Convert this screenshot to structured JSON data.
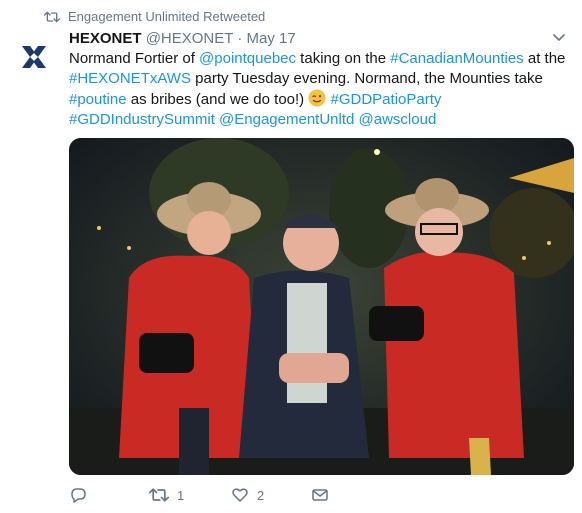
{
  "retweet_context": {
    "icon": "retweet-icon",
    "text": "Engagement Unlimited Retweeted"
  },
  "tweet": {
    "author": {
      "name": "HEXONET",
      "handle": "@HEXONET",
      "separator": "·",
      "date": "May 17",
      "avatar_icon": "hexonet-x-logo",
      "brand_color": "#1b3a6b"
    },
    "text_segments": [
      {
        "t": "Normand Fortier of "
      },
      {
        "t": "@pointquebec",
        "link": true
      },
      {
        "t": " taking on the "
      },
      {
        "t": "#CanadianMounties",
        "link": true
      },
      {
        "t": " at the "
      },
      {
        "t": "#HEXONETxAWS",
        "link": true
      },
      {
        "t": " party Tuesday evening. Normand, the Mounties take "
      },
      {
        "t": "#poutine",
        "link": true
      },
      {
        "t": " as bribes (and we do too!) "
      },
      {
        "emoji": "winking-face-emoji"
      },
      {
        "t": " "
      },
      {
        "t": "#GDDPatioParty",
        "link": true
      },
      {
        "t": " "
      },
      {
        "t": "#GDDIndustrySummit",
        "link": true
      },
      {
        "t": " "
      },
      {
        "t": "@EngagementUnltd",
        "link": true
      },
      {
        "t": " "
      },
      {
        "t": "@awscloud",
        "link": true
      }
    ],
    "link_color": "#1b95e0",
    "photo": {
      "description_icon": "tweet-photo",
      "subject": "two Mounties holding a man"
    },
    "actions": {
      "reply": {
        "icon": "reply-icon",
        "count": ""
      },
      "retweet": {
        "icon": "retweet-icon",
        "count": "1"
      },
      "like": {
        "icon": "heart-icon",
        "count": "2"
      },
      "dm": {
        "icon": "envelope-icon",
        "count": ""
      }
    }
  },
  "colors": {
    "text": "#14171a",
    "muted": "#657786",
    "link": "#1b95e0"
  }
}
